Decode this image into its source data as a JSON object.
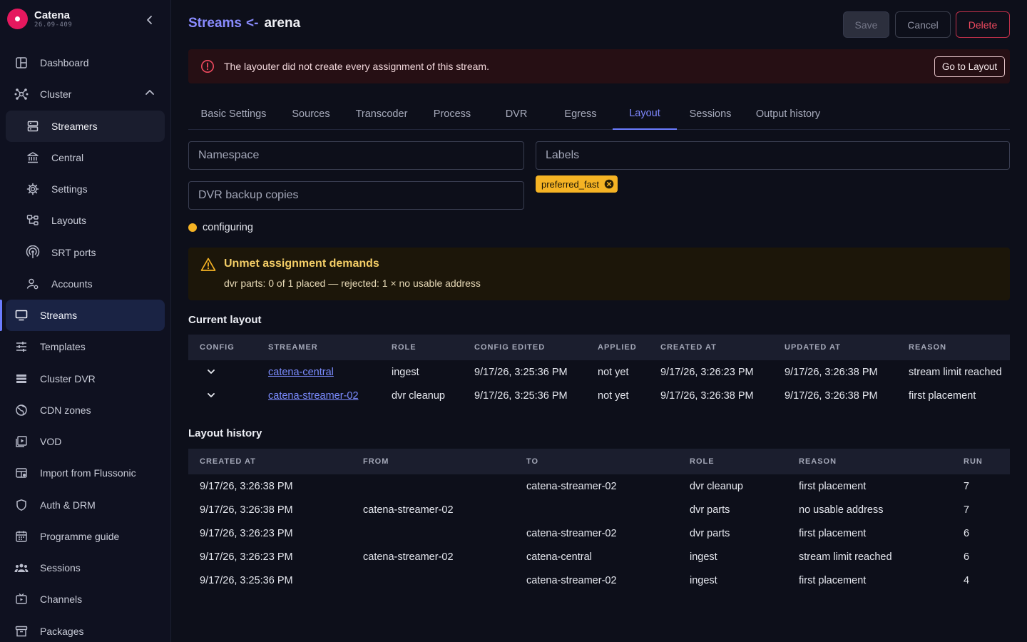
{
  "brand": {
    "name": "Catena",
    "version": "26.09-409"
  },
  "sidebar": {
    "items": [
      {
        "label": "Dashboard"
      },
      {
        "label": "Cluster"
      },
      {
        "label": "Streamers"
      },
      {
        "label": "Central"
      },
      {
        "label": "Settings"
      },
      {
        "label": "Layouts"
      },
      {
        "label": "SRT ports"
      },
      {
        "label": "Accounts"
      },
      {
        "label": "Streams"
      },
      {
        "label": "Templates"
      },
      {
        "label": "Cluster DVR"
      },
      {
        "label": "CDN zones"
      },
      {
        "label": "VOD"
      },
      {
        "label": "Import from Flussonic"
      },
      {
        "label": "Auth & DRM"
      },
      {
        "label": "Programme guide"
      },
      {
        "label": "Sessions"
      },
      {
        "label": "Channels"
      },
      {
        "label": "Packages"
      }
    ]
  },
  "header": {
    "section": "Streams",
    "arrow": "<-",
    "name": "arena",
    "save": "Save",
    "cancel": "Cancel",
    "delete": "Delete"
  },
  "alert": {
    "message": "The layouter did not create every assignment of this stream.",
    "action": "Go to Layout"
  },
  "tabs": [
    "Basic Settings",
    "Sources",
    "Transcoder",
    "Process",
    "DVR",
    "Egress",
    "Layout",
    "Sessions",
    "Output history"
  ],
  "form": {
    "namespace_placeholder": "Namespace",
    "labels_placeholder": "Labels",
    "dvr_backup_placeholder": "DVR backup copies",
    "label_chip": "preferred_fast"
  },
  "status": {
    "text": "configuring",
    "color": "#f5b324"
  },
  "warning": {
    "title": "Unmet assignment demands",
    "detail": "dvr parts: 0 of 1 placed — rejected: 1 × no usable address"
  },
  "current_layout": {
    "title": "Current layout",
    "columns": [
      "CONFIG",
      "STREAMER",
      "ROLE",
      "CONFIG EDITED",
      "APPLIED",
      "CREATED AT",
      "UPDATED AT",
      "REASON"
    ],
    "rows": [
      {
        "streamer": "catena-central",
        "role": "ingest",
        "config_edited": "9/17/26, 3:25:36 PM",
        "applied": "not yet",
        "created_at": "9/17/26, 3:26:23 PM",
        "updated_at": "9/17/26, 3:26:38 PM",
        "reason": "stream limit reached"
      },
      {
        "streamer": "catena-streamer-02",
        "role": "dvr cleanup",
        "config_edited": "9/17/26, 3:25:36 PM",
        "applied": "not yet",
        "created_at": "9/17/26, 3:26:38 PM",
        "updated_at": "9/17/26, 3:26:38 PM",
        "reason": "first placement"
      }
    ]
  },
  "layout_history": {
    "title": "Layout history",
    "columns": [
      "CREATED AT",
      "FROM",
      "TO",
      "ROLE",
      "REASON",
      "RUN"
    ],
    "rows": [
      {
        "created_at": "9/17/26, 3:26:38 PM",
        "from": "",
        "to": "catena-streamer-02",
        "role": "dvr cleanup",
        "reason": "first placement",
        "run": "7"
      },
      {
        "created_at": "9/17/26, 3:26:38 PM",
        "from": "catena-streamer-02",
        "to": "",
        "role": "dvr parts",
        "reason": "no usable address",
        "run": "7"
      },
      {
        "created_at": "9/17/26, 3:26:23 PM",
        "from": "",
        "to": "catena-streamer-02",
        "role": "dvr parts",
        "reason": "first placement",
        "run": "6"
      },
      {
        "created_at": "9/17/26, 3:26:23 PM",
        "from": "catena-streamer-02",
        "to": "catena-central",
        "role": "ingest",
        "reason": "stream limit reached",
        "run": "6"
      },
      {
        "created_at": "9/17/26, 3:25:36 PM",
        "from": "",
        "to": "catena-streamer-02",
        "role": "ingest",
        "reason": "first placement",
        "run": "4"
      }
    ]
  }
}
